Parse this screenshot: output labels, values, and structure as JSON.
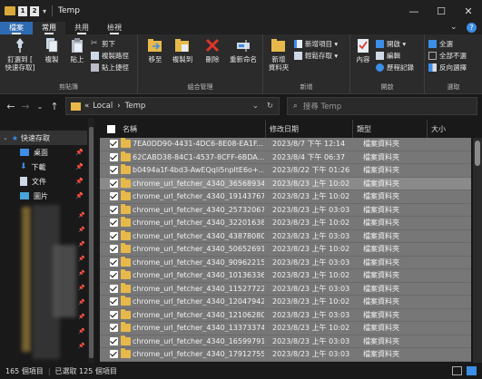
{
  "window": {
    "title": "Temp",
    "key_badges": [
      "1",
      "2"
    ],
    "controls": {
      "minimize": "—",
      "maximize": "☐",
      "close": "✕"
    }
  },
  "ribbon_tabs": [
    {
      "label": "檔案",
      "key": "F"
    },
    {
      "label": "常用",
      "key": "H"
    },
    {
      "label": "共用",
      "key": "S"
    },
    {
      "label": "檢視",
      "key": "V"
    }
  ],
  "ribbon": {
    "groups": {
      "clipboard": "剪貼簿",
      "organize": "組合管理",
      "new": "新增",
      "open": "開啟",
      "select": "選取"
    },
    "pin_quick": "釘選到 [\n快速存取]",
    "copy": "複製",
    "paste": "貼上",
    "cut": "剪下",
    "copy_path": "複製路徑",
    "paste_shortcut": "貼上捷徑",
    "move_to": "移至",
    "copy_to": "複製到",
    "delete": "刪除",
    "rename": "重新命名",
    "new_folder": "新增\n資料夾",
    "new_item": "新增項目 ▾",
    "easy_access": "輕鬆存取 ▾",
    "properties": "內容",
    "open": "開啟 ▾",
    "edit": "編輯",
    "history": "歷程記錄",
    "select_all": "全選",
    "select_none": "全部不選",
    "invert_selection": "反向選擇"
  },
  "address": {
    "prefix": "«",
    "parts": [
      "Local",
      "Temp"
    ],
    "search_placeholder": "搜尋 Temp"
  },
  "sidebar": {
    "quick_access": "快速存取",
    "items": [
      {
        "label": "桌面",
        "icon": "desktop-icon"
      },
      {
        "label": "下載",
        "icon": "download-icon"
      },
      {
        "label": "文件",
        "icon": "document-icon"
      },
      {
        "label": "圖片",
        "icon": "picture-icon"
      }
    ]
  },
  "columns": {
    "name": "名稱",
    "modified": "修改日期",
    "type": "類型",
    "size": "大小"
  },
  "files": [
    {
      "name": "7EA0DD90-4431-4DC6-8E08-EA1F...",
      "date": "2023/8/7 下午 12:14",
      "type": "檔案資料夾"
    },
    {
      "name": "62CABD38-84C1-4537-8CFF-6BDA...",
      "date": "2023/8/4 下午 06:37",
      "type": "檔案資料夾"
    },
    {
      "name": "b0494a1f-4bd3-AwEQqli5npltE6o+...",
      "date": "2023/8/22 下午 01:26",
      "type": "檔案資料夾"
    },
    {
      "name": "chrome_url_fetcher_4340_36568934",
      "date": "2023/8/23 上午 10:02",
      "type": "檔案資料夾"
    },
    {
      "name": "chrome_url_fetcher_4340_191437671",
      "date": "2023/8/23 上午 10:02",
      "type": "檔案資料夾"
    },
    {
      "name": "chrome_url_fetcher_4340_257320677",
      "date": "2023/8/23 上午 03:03",
      "type": "檔案資料夾"
    },
    {
      "name": "chrome_url_fetcher_4340_322016384",
      "date": "2023/8/23 上午 10:02",
      "type": "檔案資料夾"
    },
    {
      "name": "chrome_url_fetcher_4340_438780807",
      "date": "2023/8/23 上午 03:03",
      "type": "檔案資料夾"
    },
    {
      "name": "chrome_url_fetcher_4340_506526912",
      "date": "2023/8/23 上午 10:02",
      "type": "檔案資料夾"
    },
    {
      "name": "chrome_url_fetcher_4340_909622154",
      "date": "2023/8/23 上午 03:03",
      "type": "檔案資料夾"
    },
    {
      "name": "chrome_url_fetcher_4340_10136336...",
      "date": "2023/8/23 上午 10:02",
      "type": "檔案資料夾"
    },
    {
      "name": "chrome_url_fetcher_4340_11527722...",
      "date": "2023/8/23 上午 03:03",
      "type": "檔案資料夾"
    },
    {
      "name": "chrome_url_fetcher_4340_12047942...",
      "date": "2023/8/23 上午 10:02",
      "type": "檔案資料夾"
    },
    {
      "name": "chrome_url_fetcher_4340_12106280...",
      "date": "2023/8/23 上午 03:03",
      "type": "檔案資料夾"
    },
    {
      "name": "chrome_url_fetcher_4340_13373374...",
      "date": "2023/8/23 上午 10:02",
      "type": "檔案資料夾"
    },
    {
      "name": "chrome_url_fetcher_4340_16599791...",
      "date": "2023/8/23 上午 03:03",
      "type": "檔案資料夾"
    },
    {
      "name": "chrome_url_fetcher_4340_17912755...",
      "date": "2023/8/23 上午 03:03",
      "type": "檔案資料夾"
    }
  ],
  "status": {
    "count": "165 個項目",
    "selected": "已選取 125 個項目"
  },
  "colors": {
    "folder": "#e8b94a",
    "row_selected": "#777777",
    "delete_red": "#e0352b",
    "accent_blue": "#3c8ee6"
  }
}
